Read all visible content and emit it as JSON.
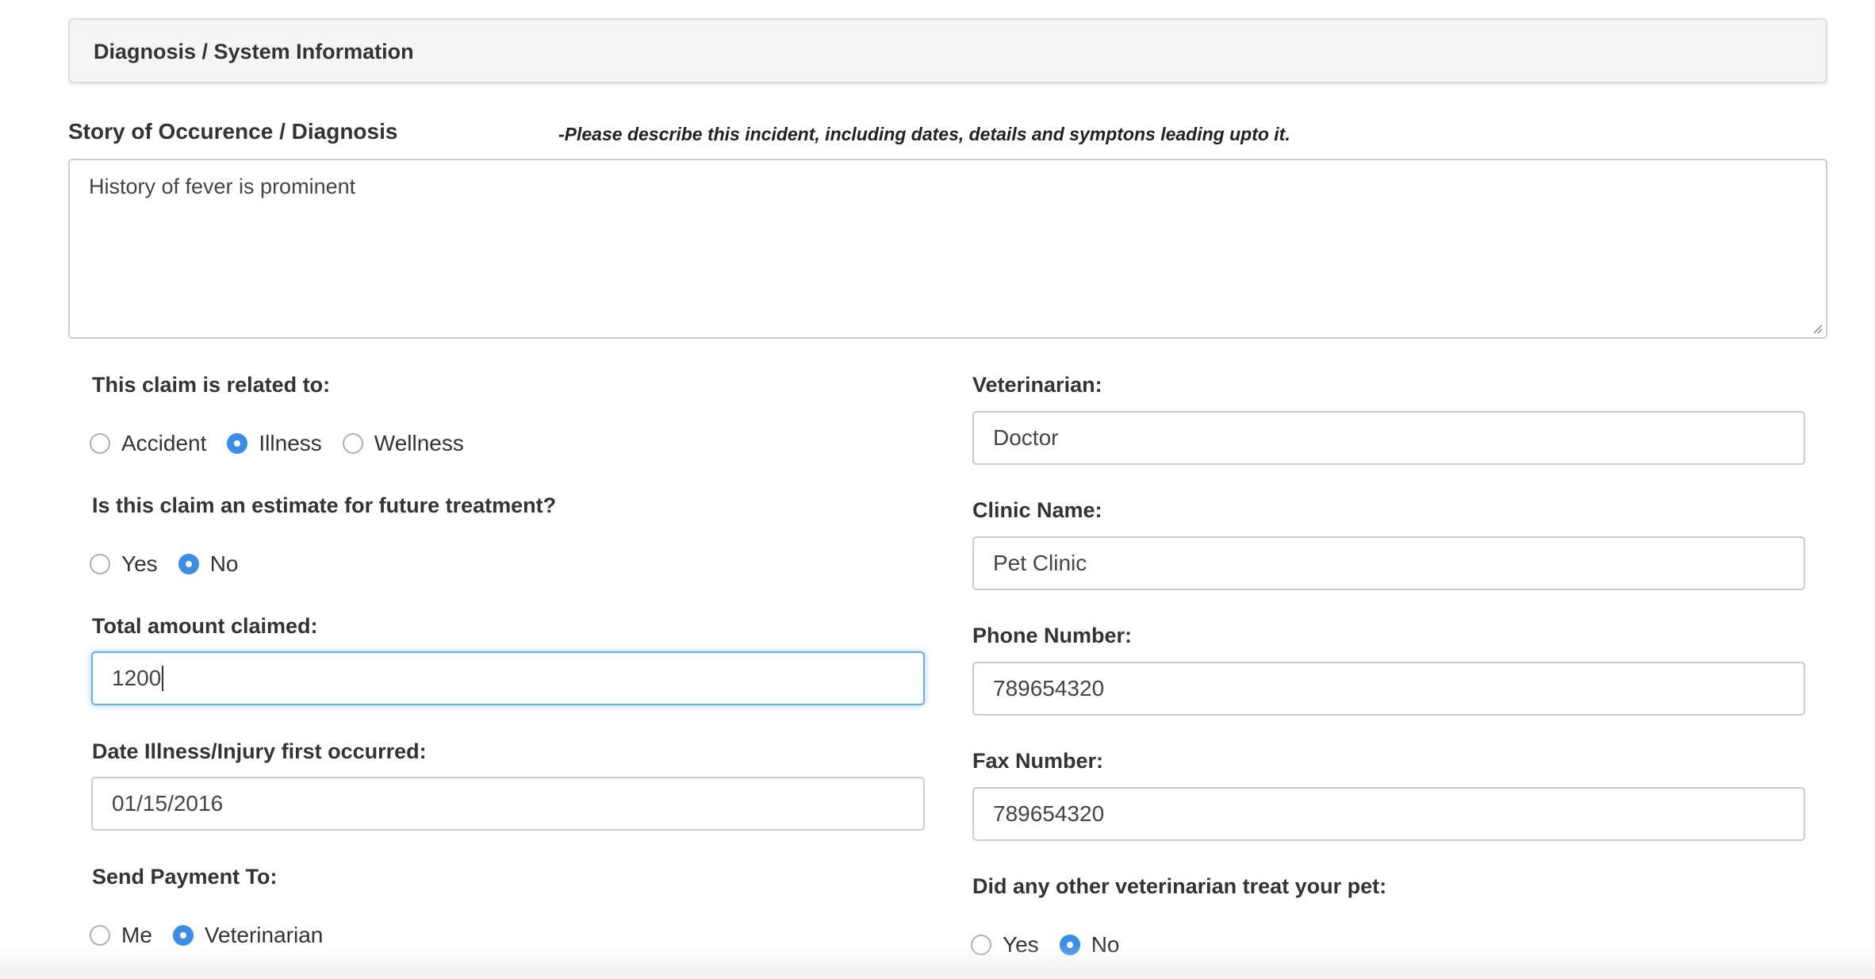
{
  "section": {
    "title": "Diagnosis / System Information"
  },
  "story": {
    "label": "Story of Occurence / Diagnosis",
    "hint": "-Please describe this incident, including dates, details and symptons leading upto it.",
    "value": "History of fever is prominent"
  },
  "left": {
    "related": {
      "label": "This claim is related to:",
      "options": [
        "Accident",
        "Illness",
        "Wellness"
      ],
      "selected": "Illness"
    },
    "estimate": {
      "label": "Is this claim an estimate for future treatment?",
      "options": [
        "Yes",
        "No"
      ],
      "selected": "No"
    },
    "total": {
      "label": "Total amount claimed:",
      "value": "1200"
    },
    "date": {
      "label": "Date Illness/Injury first occurred:",
      "value": "01/15/2016"
    },
    "payment": {
      "label": "Send Payment To:",
      "options": [
        "Me",
        "Veterinarian"
      ],
      "selected": "Veterinarian"
    }
  },
  "right": {
    "vet": {
      "label": "Veterinarian:",
      "value": "Doctor"
    },
    "clinic": {
      "label": "Clinic Name:",
      "value": "Pet Clinic"
    },
    "phone": {
      "label": "Phone Number:",
      "value": "789654320"
    },
    "fax": {
      "label": "Fax Number:",
      "value": "789654320"
    },
    "other_vet": {
      "label": "Did any other veterinarian treat your pet:",
      "options": [
        "Yes",
        "No"
      ],
      "selected": "No"
    }
  },
  "colors": {
    "accent": "#3a8ee6",
    "focus_border": "#66afe9",
    "header_bg": "#f5f5f5"
  },
  "icons": {
    "resize": "resize-grip-icon"
  }
}
